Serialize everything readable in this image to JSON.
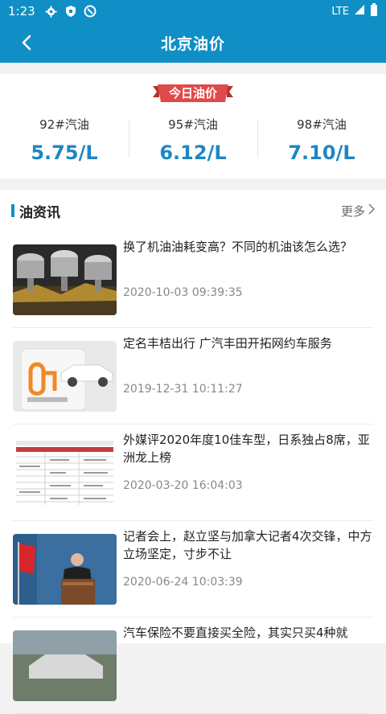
{
  "status_bar": {
    "time": "1:23",
    "network": "LTE",
    "icons": [
      "gear-icon",
      "shield-icon",
      "no-disturb-icon",
      "signal-icon",
      "battery-icon"
    ]
  },
  "app_bar": {
    "title": "北京油价",
    "back_icon": "back-arrow-icon"
  },
  "price_card": {
    "ribbon_label": "今日油价",
    "prices": [
      {
        "grade": "92#汽油",
        "price": "5.75/L"
      },
      {
        "grade": "95#汽油",
        "price": "6.12/L"
      },
      {
        "grade": "98#汽油",
        "price": "7.10/L"
      }
    ]
  },
  "news": {
    "heading": "油资讯",
    "more_label": "更多",
    "items": [
      {
        "headline": "换了机油油耗变高？不同的机油该怎么选？",
        "date": "2020-10-03 09:39:35",
        "thumb": "engine-pistons-image"
      },
      {
        "headline": "定名丰桔出行 广汽丰田开拓网约车服务",
        "date": "2019-12-31 10:11:27",
        "thumb": "didi-car-image"
      },
      {
        "headline": "外媒评2020年度10佳车型，日系独占8席，亚洲龙上榜",
        "date": "2020-03-20 16:04:03",
        "thumb": "ranking-table-image"
      },
      {
        "headline": "记者会上，赵立坚与加拿大记者4次交锋，中方立场坚定，寸步不让",
        "date": "2020-06-24 10:03:39",
        "thumb": "press-conference-image"
      },
      {
        "headline": "汽车保险不要直接买全险，其实只买4种就",
        "date": "",
        "thumb": "car-photo-image"
      }
    ]
  },
  "colors": {
    "primary": "#0f8fc6",
    "price": "#1d87c4",
    "ribbon": "#e04a4a"
  }
}
